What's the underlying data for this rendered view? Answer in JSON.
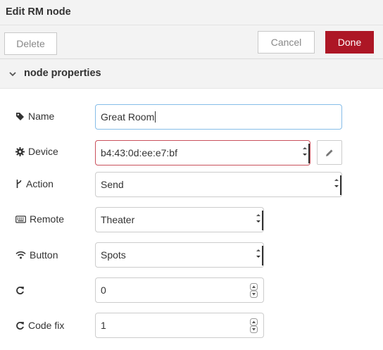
{
  "header": {
    "title": "Edit RM node"
  },
  "toolbar": {
    "delete_label": "Delete",
    "cancel_label": "Cancel",
    "done_label": "Done"
  },
  "section": {
    "label": "node properties"
  },
  "fields": {
    "name": {
      "label": "Name",
      "value": "Great Room",
      "icon": "tag-icon"
    },
    "device": {
      "label": "Device",
      "value": "b4:43:0d:ee:e7:bf",
      "icon": "gear-icon"
    },
    "action": {
      "label": "Action",
      "value": "Send",
      "icon": "fork-icon"
    },
    "remote": {
      "label": "Remote",
      "value": "Theater",
      "icon": "keyboard-icon"
    },
    "button": {
      "label": "Button",
      "value": "Spots",
      "icon": "wifi-icon"
    },
    "repeat": {
      "label": "",
      "value": "0",
      "icon": "refresh-icon"
    },
    "codefix": {
      "label": "Code fix",
      "value": "1",
      "icon": "refresh-icon"
    }
  },
  "colors": {
    "done": "#ad1625",
    "focus_border": "#86bde8",
    "error_border": "#c9515c"
  }
}
